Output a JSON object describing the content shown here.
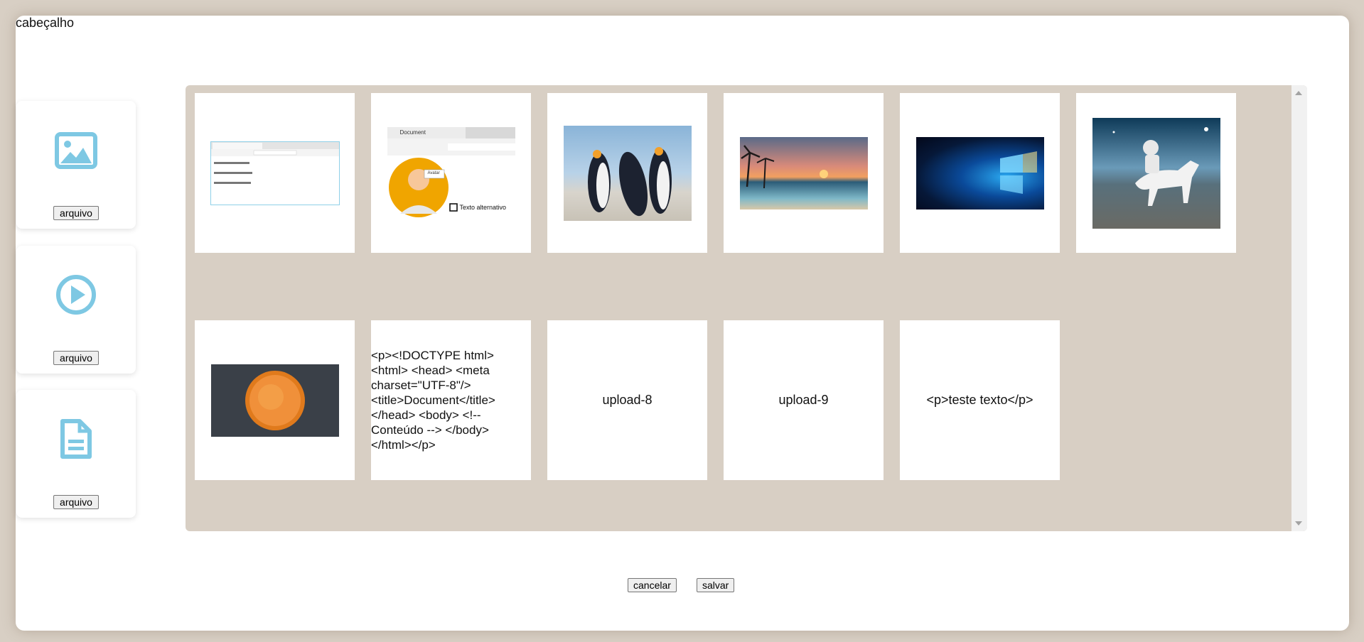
{
  "header": {
    "title": "cabeçalho"
  },
  "sidebar": {
    "cards": [
      {
        "icon": "image-icon",
        "button_label": "arquivo"
      },
      {
        "icon": "play-circle-icon",
        "button_label": "arquivo"
      },
      {
        "icon": "document-icon",
        "button_label": "arquivo"
      }
    ]
  },
  "gallery": {
    "tiles": [
      {
        "kind": "image",
        "subject": "browser document screenshot"
      },
      {
        "kind": "image",
        "subject": "browser with avatar and alt text",
        "alt_text": "Texto alternativo",
        "tab_title": "Document",
        "tooltip": "Avatar"
      },
      {
        "kind": "image",
        "subject": "penguins"
      },
      {
        "kind": "image",
        "subject": "sunset beach painting"
      },
      {
        "kind": "image",
        "subject": "windows wallpaper"
      },
      {
        "kind": "image",
        "subject": "astronaut riding horse"
      },
      {
        "kind": "image",
        "subject": "sun"
      },
      {
        "kind": "text",
        "text": "<p><!DOCTYPE html> <html> <head> <meta charset=\"UTF-8\"/> <title>Document</title> </head> <body> <!-- Conteúdo --> </body> </html></p>"
      },
      {
        "kind": "broken-image",
        "alt": "upload-8"
      },
      {
        "kind": "broken-image",
        "alt": "upload-9"
      },
      {
        "kind": "text",
        "text": "<p>teste texto</p>"
      }
    ]
  },
  "footer": {
    "cancel_label": "cancelar",
    "save_label": "salvar"
  },
  "colors": {
    "background": "#d8cfc4",
    "icon": "#7ec8e3",
    "panel": "#ffffff"
  }
}
